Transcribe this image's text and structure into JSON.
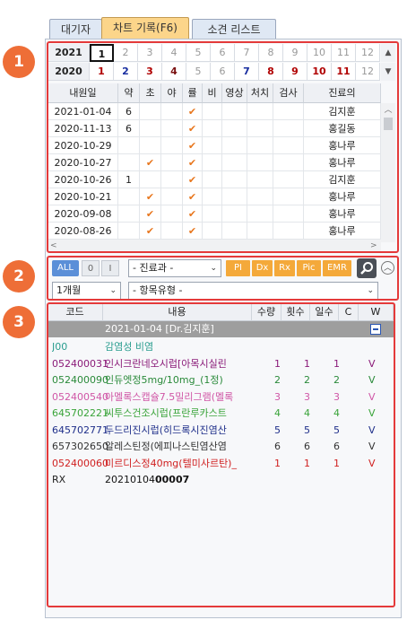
{
  "tabs": [
    {
      "label": "대기자"
    },
    {
      "label": "차트 기록(F6)"
    },
    {
      "label": "소견 리스트"
    }
  ],
  "markers": [
    "1",
    "2",
    "3"
  ],
  "years": [
    {
      "year": "2021",
      "months": [
        "1",
        "2",
        "3",
        "4",
        "5",
        "6",
        "7",
        "8",
        "9",
        "10",
        "11",
        "12"
      ]
    },
    {
      "year": "2020",
      "months": [
        "1",
        "2",
        "3",
        "4",
        "5",
        "6",
        "7",
        "8",
        "9",
        "10",
        "11",
        "12"
      ]
    }
  ],
  "visit_table": {
    "headers": [
      "내원일",
      "약",
      "초",
      "야",
      "률",
      "비",
      "영상",
      "처치",
      "검사",
      "진료의"
    ],
    "rows": [
      {
        "date": "2021-01-04",
        "yak": "6",
        "cho": "",
        "ya": "",
        "ryul": "✔",
        "doctor": "김지훈"
      },
      {
        "date": "2020-11-13",
        "yak": "6",
        "cho": "",
        "ya": "",
        "ryul": "✔",
        "doctor": "홍길동"
      },
      {
        "date": "2020-10-29",
        "yak": "",
        "cho": "",
        "ya": "",
        "ryul": "✔",
        "doctor": "홍나루"
      },
      {
        "date": "2020-10-27",
        "yak": "",
        "cho": "✔",
        "ya": "",
        "ryul": "✔",
        "doctor": "홍나루"
      },
      {
        "date": "2020-10-26",
        "yak": "1",
        "cho": "",
        "ya": "",
        "ryul": "✔",
        "doctor": "김지훈"
      },
      {
        "date": "2020-10-21",
        "yak": "",
        "cho": "✔",
        "ya": "",
        "ryul": "✔",
        "doctor": "홍나루"
      },
      {
        "date": "2020-09-08",
        "yak": "",
        "cho": "✔",
        "ya": "",
        "ryul": "✔",
        "doctor": "홍나루"
      },
      {
        "date": "2020-08-26",
        "yak": "",
        "cho": "✔",
        "ya": "",
        "ryul": "✔",
        "doctor": "홍나루"
      }
    ]
  },
  "filter": {
    "all_label": "ALL",
    "o_label": "0",
    "i_label": "I",
    "department_select": "- 진료과 -",
    "category_buttons": [
      "PI",
      "Dx",
      "Rx",
      "Pic",
      "EMR"
    ],
    "period_select": "1개월",
    "item_type_select": "- 항목유형 -"
  },
  "rx_table": {
    "headers": [
      "코드",
      "내용",
      "수량",
      "횟수",
      "일수",
      "C",
      "W"
    ],
    "group_header": "2021-01-04 [Dr.김지훈]",
    "rows": [
      {
        "code": "J00",
        "name": "감염성 비염",
        "qty": "",
        "times": "",
        "days": "",
        "w": "",
        "color": "#2a9d8f"
      },
      {
        "code": "052400031",
        "name": "인시크란네오시럽[아목시실린",
        "qty": "1",
        "times": "1",
        "days": "1",
        "w": "V",
        "color": "#8a1a78"
      },
      {
        "code": "052400090",
        "name": "인듀엣정5mg/10mg_(1정)",
        "qty": "2",
        "times": "2",
        "days": "2",
        "w": "V",
        "color": "#2a8a3a"
      },
      {
        "code": "052400540",
        "name": "아멜록스캡슐7.5밀리그램(멜록",
        "qty": "3",
        "times": "3",
        "days": "3",
        "w": "V",
        "color": "#d056a6"
      },
      {
        "code": "645702221",
        "name": "씨투스건조시럽(프란루카스트",
        "qty": "4",
        "times": "4",
        "days": "4",
        "w": "V",
        "color": "#3aa43a"
      },
      {
        "code": "645702771",
        "name": "두드리진시럽(히드록시진염산",
        "qty": "5",
        "times": "5",
        "days": "5",
        "w": "V",
        "color": "#1f2f8a"
      },
      {
        "code": "657302650",
        "name": "알레스틴정(에피나스틴염산염",
        "qty": "6",
        "times": "6",
        "days": "6",
        "w": "V",
        "color": "#333333"
      },
      {
        "code": "052400060",
        "name": "미르디스정40mg(텔미사르탄)_",
        "qty": "1",
        "times": "1",
        "days": "1",
        "w": "V",
        "color": "#d02020"
      },
      {
        "code": "RX",
        "name_prefix": "20210104",
        "name_bold": "00007",
        "qty": "",
        "times": "",
        "days": "",
        "w": "",
        "color": "#222222"
      }
    ]
  },
  "colors": {
    "accent_red": "#e43a3a",
    "marker_orange": "#ee6e37",
    "active_tab": "#fcd58a",
    "group_header_bg": "#9e9e9e",
    "check_orange": "#e8761d"
  }
}
